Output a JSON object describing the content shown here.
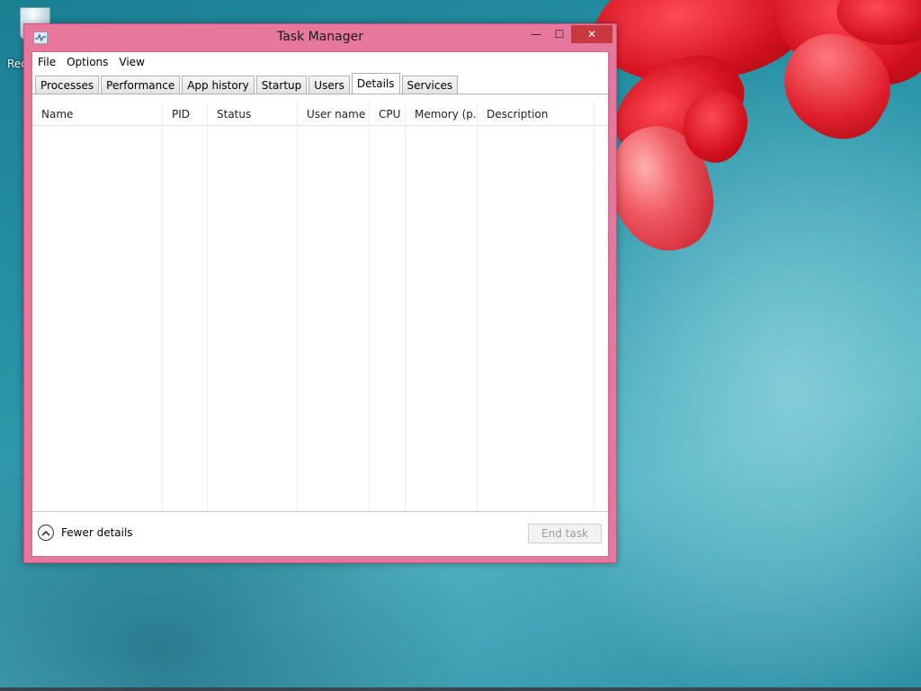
{
  "desktop": {
    "recycle_bin_label": "Rec"
  },
  "window": {
    "title": "Task Manager",
    "minimize_glyph": "—",
    "maximize_glyph": "☐",
    "close_glyph": "✕",
    "accent_color": "#e8779e"
  },
  "menu": {
    "items": [
      "File",
      "Options",
      "View"
    ]
  },
  "tabs": {
    "items": [
      "Processes",
      "Performance",
      "App history",
      "Startup",
      "Users",
      "Details",
      "Services"
    ],
    "active": "Details"
  },
  "table": {
    "columns": [
      "Name",
      "PID",
      "Status",
      "User name",
      "CPU",
      "Memory (p...",
      "Description"
    ],
    "sort_column": "Name",
    "sort_indicator": "ˆ",
    "rows": []
  },
  "footer": {
    "fewer_details_label": "Fewer details",
    "end_task_label": "End task",
    "end_task_enabled": false
  }
}
